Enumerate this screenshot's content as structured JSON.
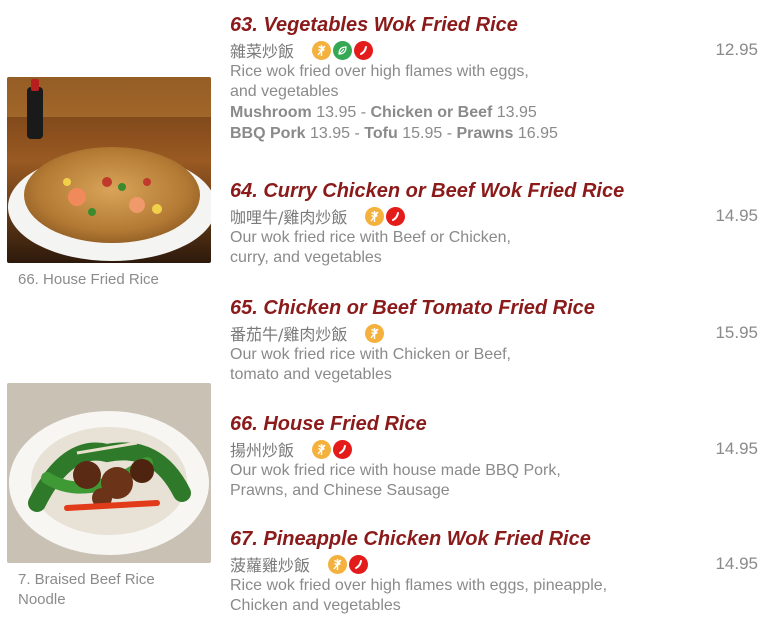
{
  "photos": [
    {
      "caption": "66. House Fried Rice"
    },
    {
      "caption": "7. Braised Beef Rice Noodle"
    }
  ],
  "items": [
    {
      "title": "63. Vegetables Wok Fried Rice",
      "chinese": "雜菜炒飯",
      "price": "12.95",
      "icons": [
        "gluten-free-icon",
        "vegetarian-icon",
        "spicy-icon"
      ],
      "desc_lines": [
        "Rice wok fried over high flames with eggs,",
        "and vegetables"
      ],
      "extras": [
        [
          {
            "name": "Mushroom",
            "price": "13.95"
          },
          {
            "name": "Chicken or Beef",
            "price": "13.95"
          }
        ],
        [
          {
            "name": "BBQ Pork",
            "price": "13.95"
          },
          {
            "name": "Tofu",
            "price": "15.95"
          },
          {
            "name": "Prawns",
            "price": "16.95"
          }
        ]
      ]
    },
    {
      "title": "64. Curry Chicken or Beef Wok Fried Rice",
      "chinese": "咖哩牛/雞肉炒飯",
      "price": "14.95",
      "icons": [
        "gluten-free-icon",
        "spicy-icon"
      ],
      "desc_lines": [
        "Our wok fried rice with Beef or Chicken,",
        "curry, and vegetables"
      ]
    },
    {
      "title": "65. Chicken or Beef Tomato Fried Rice",
      "chinese": "番茄牛/雞肉炒飯",
      "price": "15.95",
      "icons": [
        "gluten-free-icon"
      ],
      "desc_lines": [
        "Our wok fried rice with Chicken or Beef,",
        "tomato and vegetables"
      ]
    },
    {
      "title": "66. House Fried Rice",
      "chinese": "揚州炒飯",
      "price": "14.95",
      "icons": [
        "gluten-free-icon",
        "spicy-icon"
      ],
      "desc_lines": [
        "Our wok fried rice with house made BBQ Pork,",
        "Prawns, and Chinese Sausage"
      ]
    },
    {
      "title": "67. Pineapple Chicken Wok Fried Rice",
      "chinese": "菠蘿雞炒飯",
      "price": "14.95",
      "icons": [
        "gluten-free-icon",
        "spicy-icon"
      ],
      "desc_lines": [
        "Rice wok fried over high flames with eggs, pineapple,",
        "Chicken and vegetables"
      ]
    }
  ],
  "colors": {
    "title": "#8b1a1a",
    "text": "#8a8a8a",
    "gluten_free": "#f4b13d",
    "vegetarian": "#34a853",
    "spicy": "#e41b1b"
  }
}
